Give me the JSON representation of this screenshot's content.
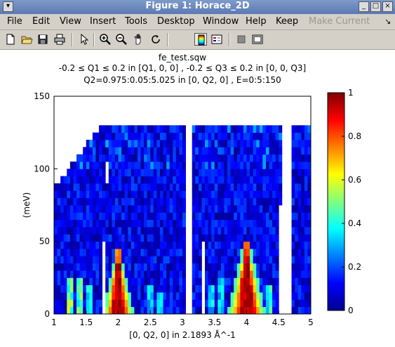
{
  "window": {
    "title": "Figure 1: Horace_2D",
    "controls": [
      "menu",
      "minimize",
      "maximize",
      "close"
    ]
  },
  "menu": {
    "items": [
      {
        "label": "File",
        "enabled": true
      },
      {
        "label": "Edit",
        "enabled": true
      },
      {
        "label": "View",
        "enabled": true
      },
      {
        "label": "Insert",
        "enabled": true
      },
      {
        "label": "Tools",
        "enabled": true
      },
      {
        "label": "Desktop",
        "enabled": true
      },
      {
        "label": "Window",
        "enabled": true
      },
      {
        "label": "Help",
        "enabled": true
      },
      {
        "label": "Keep",
        "enabled": true
      },
      {
        "label": "Make Current",
        "enabled": false
      }
    ],
    "overflow_arrow": "↘"
  },
  "toolbar": {
    "tools": [
      "new-figure-icon",
      "open-file-icon",
      "save-icon",
      "print-icon",
      "edit-pointer-icon",
      "zoom-in-icon",
      "zoom-out-icon",
      "pan-hand-icon",
      "rotate-3d-icon",
      "colorbar-icon",
      "legend-icon",
      "hide-plot-tools-icon",
      "show-plot-tools-icon"
    ],
    "active": [
      "colorbar-icon"
    ]
  },
  "figure": {
    "title_line1": "fe_test.sqw",
    "title_line2": "-0.2 ≤ Q1 ≤ 0.2 in [Q1, 0, 0] , -0.2 ≤ Q3 ≤ 0.2 in [0, 0, Q3]",
    "title_line3": "Q2=0.975:0.05:5.025 in [0, Q2, 0] , E=0:5:150",
    "xlabel": "[0, Q2, 0] in 2.1893 Å^-1",
    "ylabel": "(meV)"
  },
  "chart_data": {
    "type": "heatmap",
    "colormap": "jet",
    "xlim": [
      1,
      5
    ],
    "ylim": [
      0,
      150
    ],
    "clim": [
      0,
      1
    ],
    "x_ticks": [
      "1",
      "1.5",
      "2",
      "2.5",
      "3",
      "3.5",
      "4",
      "4.5",
      "5"
    ],
    "y_ticks": [
      "0",
      "50",
      "100",
      "150"
    ],
    "colorbar_ticks": [
      "0",
      "0.2",
      "0.4",
      "0.6",
      "0.8",
      "1"
    ],
    "x_bin_width": 0.05,
    "y_bin_width": 5,
    "data_upper_edge": [
      {
        "x": 1.0,
        "y": 90
      },
      {
        "x": 1.05,
        "y": 90
      },
      {
        "x": 1.1,
        "y": 95
      },
      {
        "x": 1.15,
        "y": 95
      },
      {
        "x": 1.2,
        "y": 100
      },
      {
        "x": 1.25,
        "y": 105
      },
      {
        "x": 1.3,
        "y": 105
      },
      {
        "x": 1.35,
        "y": 110
      },
      {
        "x": 1.4,
        "y": 110
      },
      {
        "x": 1.45,
        "y": 115
      },
      {
        "x": 1.5,
        "y": 120
      },
      {
        "x": 1.55,
        "y": 120
      },
      {
        "x": 1.6,
        "y": 125
      },
      {
        "x": 1.65,
        "y": 125
      },
      {
        "x": 1.7,
        "y": 130
      },
      {
        "x": 1.75,
        "y": 130
      },
      {
        "x": 1.8,
        "y": 130
      },
      {
        "x": 4.95,
        "y": 130
      }
    ],
    "gaps": [
      {
        "x": [
          1.8,
          1.85
        ],
        "y": [
          90,
          105
        ]
      },
      {
        "x": [
          1.75,
          1.8
        ],
        "y": [
          0,
          50
        ]
      },
      {
        "x": [
          3.05,
          3.15
        ],
        "y": [
          0,
          130
        ]
      },
      {
        "x": [
          3.1,
          3.15
        ],
        "y": [
          0,
          150
        ]
      },
      {
        "x": [
          3.3,
          3.35
        ],
        "y": [
          0,
          50
        ]
      },
      {
        "x": [
          4.55,
          4.7
        ],
        "y": [
          0,
          130
        ]
      },
      {
        "x": [
          4.5,
          4.55
        ],
        "y": [
          0,
          75
        ]
      }
    ],
    "peaks": [
      {
        "x": 2.0,
        "top_energy": 45,
        "base_halfwidth": 0.2
      },
      {
        "x": 4.0,
        "top_energy": 50,
        "base_halfwidth": 0.25
      }
    ],
    "low_energy_features": [
      {
        "x": 1.25,
        "intensity": 0.6,
        "height": 25
      },
      {
        "x": 1.4,
        "intensity": 0.55,
        "height": 25
      },
      {
        "x": 1.55,
        "intensity": 0.45,
        "height": 20
      },
      {
        "x": 2.5,
        "intensity": 0.4,
        "height": 20
      },
      {
        "x": 2.65,
        "intensity": 0.4,
        "height": 15
      },
      {
        "x": 3.45,
        "intensity": 0.4,
        "height": 20
      },
      {
        "x": 3.6,
        "intensity": 0.4,
        "height": 25
      },
      {
        "x": 4.35,
        "intensity": 0.5,
        "height": 20
      }
    ]
  }
}
